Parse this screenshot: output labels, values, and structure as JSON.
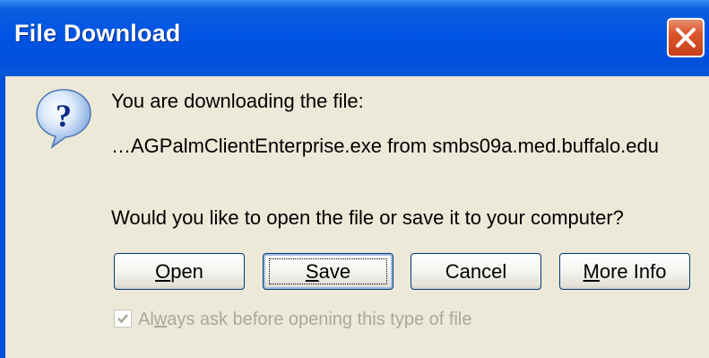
{
  "window": {
    "title": "File Download"
  },
  "message": {
    "intro": "You are downloading the file:",
    "file_line": "…AGPalmClientEnterprise.exe from smbs09a.med.buffalo.edu",
    "question": "Would you like to open the file or save it to your computer?"
  },
  "buttons": {
    "open": {
      "pre": "",
      "accel": "O",
      "post": "pen"
    },
    "save": {
      "pre": "",
      "accel": "S",
      "post": "ave"
    },
    "cancel": {
      "label": "Cancel"
    },
    "more_info": {
      "pre": "",
      "accel": "M",
      "post": "ore Info"
    }
  },
  "checkbox": {
    "checked": true,
    "enabled": false,
    "label_pre": "Al",
    "label_accel": "w",
    "label_post": "ays ask before opening this type of file"
  },
  "colors": {
    "titlebar": "#0054e3",
    "dialog_bg": "#ece9d8",
    "close_button": "#d9542b",
    "disabled_text": "#aca899"
  },
  "icons": {
    "dialog_icon": "question-icon",
    "close": "close-icon",
    "checkmark": "checkmark-icon"
  }
}
